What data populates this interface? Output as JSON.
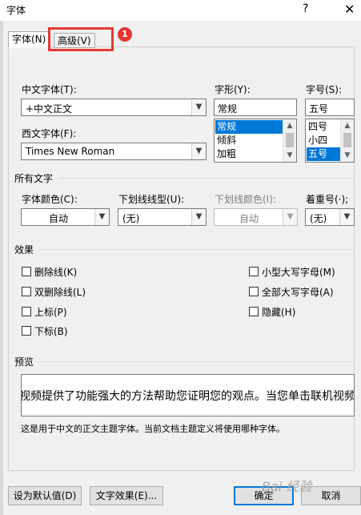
{
  "window": {
    "title": "字体",
    "help_label": "?",
    "close_label": "✕"
  },
  "tabs": [
    {
      "label": "字体(N)"
    },
    {
      "label": "高级(V)"
    }
  ],
  "annotation_badge": "1",
  "chinese_font": {
    "label": "中文字体(T):",
    "value": "+中文正文"
  },
  "western_font": {
    "label": "西文字体(F):",
    "value": "Times New Roman"
  },
  "style": {
    "label": "字形(Y):",
    "value": "常规",
    "options": [
      "常规",
      "倾斜",
      "加粗"
    ],
    "selected": "常规"
  },
  "size": {
    "label": "字号(S):",
    "value": "五号",
    "options": [
      "四号",
      "小四",
      "五号"
    ],
    "selected": "五号"
  },
  "all_text": {
    "section_label": "所有文字",
    "font_color": {
      "label": "字体颜色(C):",
      "value": "自动"
    },
    "underline_type": {
      "label": "下划线线型(U):",
      "value": "(无)"
    },
    "underline_color": {
      "label": "下划线颜色(I):",
      "value": "自动"
    },
    "emphasis_mark": {
      "label": "着重号(·);",
      "value": "(无)"
    }
  },
  "effects": {
    "section_label": "效果",
    "strikethrough": "删除线(K)",
    "double_strikethrough": "双删除线(L)",
    "superscript": "上标(P)",
    "subscript": "下标(B)",
    "small_caps": "小型大写字母(M)",
    "all_caps": "全部大写字母(A)",
    "hidden": "隐藏(H)"
  },
  "preview": {
    "section_label": "预览",
    "sample_text": "视频提供了功能强大的方法帮助您证明您的观点。当您单击联机视频",
    "description": "这是用于中文的正文主题字体。当前文档主题定义将使用哪种字体。"
  },
  "buttons": {
    "set_default": "设为默认值(D)",
    "text_effects": "文字效果(E)...",
    "ok": "确定",
    "cancel": "取消"
  },
  "watermark": "Bai 经验"
}
